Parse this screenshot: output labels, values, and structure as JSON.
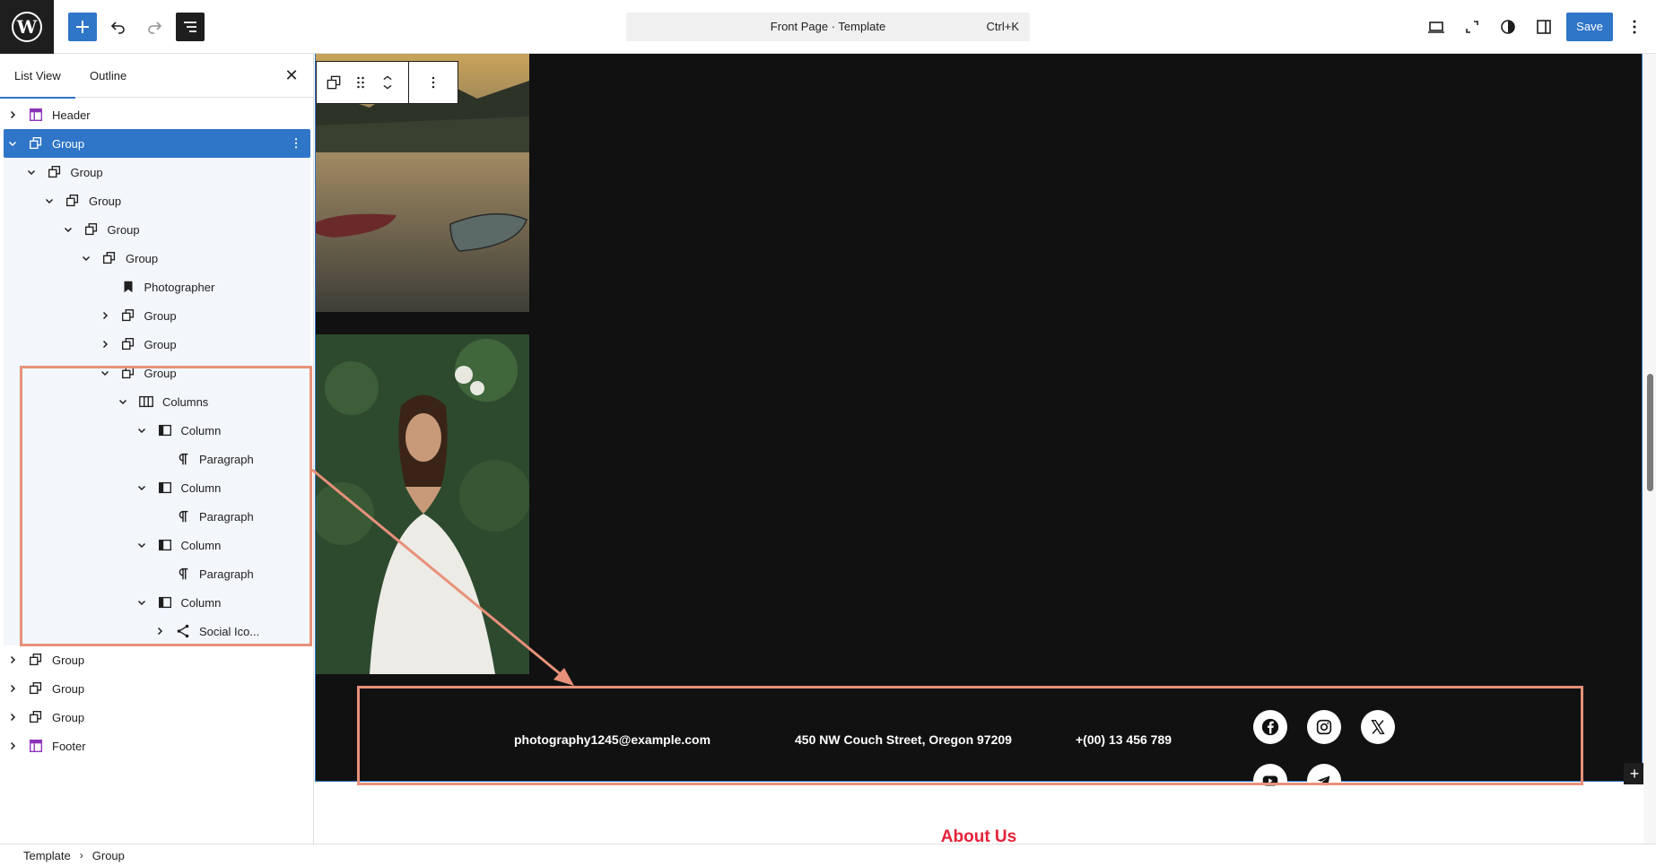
{
  "topbar": {
    "command_title": "Front Page · Template",
    "command_shortcut": "Ctrl+K",
    "save_label": "Save",
    "accent": "#2f75c8"
  },
  "sidebar": {
    "tabs": [
      {
        "label": "List View",
        "active": true
      },
      {
        "label": "Outline",
        "active": false
      }
    ],
    "tree": [
      {
        "label": "Header",
        "depth": 0,
        "expander": "collapsed",
        "icon": "template-part-icon"
      },
      {
        "label": "Group",
        "depth": 0,
        "expander": "expanded",
        "icon": "group-icon",
        "selected": true
      },
      {
        "label": "Group",
        "depth": 1,
        "expander": "expanded",
        "icon": "group-icon"
      },
      {
        "label": "Group",
        "depth": 2,
        "expander": "expanded",
        "icon": "group-icon"
      },
      {
        "label": "Group",
        "depth": 3,
        "expander": "expanded",
        "icon": "group-icon"
      },
      {
        "label": "Group",
        "depth": 4,
        "expander": "expanded",
        "icon": "group-icon"
      },
      {
        "label": "Photographer",
        "depth": 5,
        "expander": "none",
        "icon": "bookmark-icon"
      },
      {
        "label": "Group",
        "depth": 5,
        "expander": "collapsed",
        "icon": "group-icon"
      },
      {
        "label": "Group",
        "depth": 5,
        "expander": "collapsed",
        "icon": "group-icon"
      },
      {
        "label": "Group",
        "depth": 5,
        "expander": "expanded",
        "icon": "group-icon"
      },
      {
        "label": "Columns",
        "depth": 6,
        "expander": "expanded",
        "icon": "columns-icon"
      },
      {
        "label": "Column",
        "depth": 7,
        "expander": "expanded",
        "icon": "column-icon"
      },
      {
        "label": "Paragraph",
        "depth": 8,
        "expander": "none",
        "icon": "paragraph-icon"
      },
      {
        "label": "Column",
        "depth": 7,
        "expander": "expanded",
        "icon": "column-icon"
      },
      {
        "label": "Paragraph",
        "depth": 8,
        "expander": "none",
        "icon": "paragraph-icon"
      },
      {
        "label": "Column",
        "depth": 7,
        "expander": "expanded",
        "icon": "column-icon"
      },
      {
        "label": "Paragraph",
        "depth": 8,
        "expander": "none",
        "icon": "paragraph-icon"
      },
      {
        "label": "Column",
        "depth": 7,
        "expander": "expanded",
        "icon": "column-icon"
      },
      {
        "label": "Social Ico...",
        "depth": 8,
        "expander": "collapsed",
        "icon": "share-icon"
      },
      {
        "label": "Group",
        "depth": 0,
        "expander": "collapsed",
        "icon": "group-icon"
      },
      {
        "label": "Group",
        "depth": 0,
        "expander": "collapsed",
        "icon": "group-icon"
      },
      {
        "label": "Group",
        "depth": 0,
        "expander": "collapsed",
        "icon": "group-icon"
      },
      {
        "label": "Footer",
        "depth": 0,
        "expander": "collapsed",
        "icon": "template-part-icon"
      }
    ]
  },
  "canvas": {
    "footer": {
      "email": "photography1245@example.com",
      "address": "450 NW Couch Street, Oregon 97209",
      "phone": "+(00) 13 456 789",
      "social": [
        "facebook-icon",
        "instagram-icon",
        "x-icon",
        "youtube-icon",
        "telegram-icon"
      ]
    },
    "about_heading": "About Us",
    "about_color": "#e5233a",
    "highlight_color": "#e8917a"
  },
  "breadcrumb": {
    "items": [
      "Template",
      "Group"
    ]
  }
}
